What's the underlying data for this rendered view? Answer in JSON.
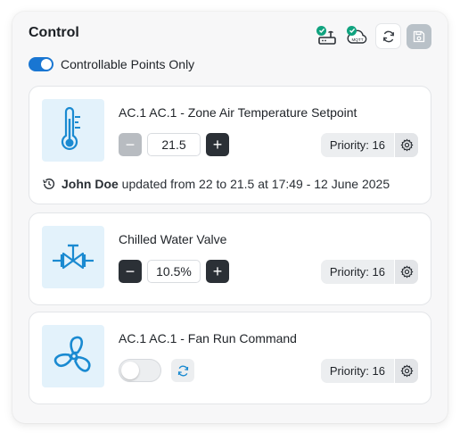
{
  "header": {
    "title": "Control",
    "icons": [
      "gateway-status-icon",
      "mqtt-status-icon",
      "refresh-icon",
      "save-icon"
    ],
    "mqtt_label": "MQTT"
  },
  "filter": {
    "label": "Controllable Points Only",
    "enabled": true
  },
  "points": [
    {
      "title": "AC.1 AC.1 - Zone Air Temperature Setpoint",
      "icon": "thermometer-icon",
      "value": "21.5",
      "minus_label": "−",
      "plus_label": "+",
      "priority": "Priority: 16",
      "history": {
        "user": "John Doe",
        "text": "updated from 22 to 21.5 at 17:49 - 12 June 2025"
      }
    },
    {
      "title": "Chilled Water Valve",
      "icon": "valve-icon",
      "value": "10.5%",
      "minus_label": "−",
      "plus_label": "+",
      "priority": "Priority: 16"
    },
    {
      "title": "AC.1 AC.1 - Fan Run Command",
      "icon": "fan-icon",
      "state": "off",
      "priority": "Priority: 16"
    }
  ],
  "colors": {
    "accent": "#1976d2",
    "icon_blue": "#1a8ad1",
    "status_green": "#10a37f"
  }
}
